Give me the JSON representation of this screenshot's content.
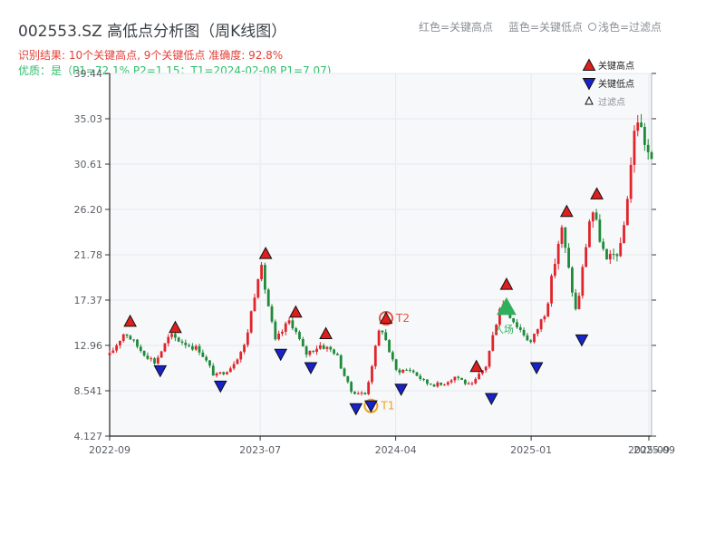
{
  "header": {
    "title": "002553.SZ 高低点分析图（周K线图）",
    "summary": "识别结果: 10个关键高点, 9个关键低点  准确度: 92.8%",
    "quality": "优质：是（P1=72.1%  P2=1.15；T1=2024-02-08 P1=7.07)",
    "legend_top": [
      "红色=关键高点",
      "蓝色=关键低点",
      "浅色=过滤点"
    ]
  },
  "colors": {
    "up": "#e0242b",
    "down": "#1e8a3a",
    "high_marker": "#e01e1e",
    "low_marker": "#1722c8",
    "t1": "#f0a020",
    "t2": "#e05540",
    "entry": "#2fae5c",
    "plot_bg": "#f7f8fa",
    "grid": "#e6e8ec"
  },
  "chart_data": {
    "type": "candlestick",
    "y_ticks": [
      4.127,
      8.541,
      12.96,
      17.37,
      21.78,
      26.2,
      30.61,
      35.03,
      39.44
    ],
    "y_tick_labels": [
      "4.127",
      "8.541",
      "12.96",
      "17.37",
      "21.78",
      "26.20",
      "30.61",
      "35.03",
      "39.44"
    ],
    "ylim": [
      4.127,
      39.44
    ],
    "x_ticks": [
      "2022-09",
      "2023-07",
      "2024-04",
      "2025-01",
      "2025-09"
    ],
    "x_tick_labels_shown": [
      "2022-09",
      "2023-07",
      "2024-04",
      "2025-01",
      "2025-09",
      "2025-09"
    ],
    "xlim": [
      "2022-09",
      "2025-09"
    ],
    "legend": [
      "关键高点",
      "关键低点",
      "过滤点"
    ],
    "legend_placement": "top-right",
    "grid": true,
    "price_path": [
      [
        "2022-09",
        12.0
      ],
      [
        "2022-10",
        14.3
      ],
      [
        "2022-11",
        12.6
      ],
      [
        "2022-12",
        11.3
      ],
      [
        "2023-01",
        13.9
      ],
      [
        "2023-02",
        13.2
      ],
      [
        "2023-03",
        12.5
      ],
      [
        "2023-04",
        9.9
      ],
      [
        "2023-05",
        10.8
      ],
      [
        "2023-06",
        13.0
      ],
      [
        "2023-07",
        21.0
      ],
      [
        "2023-08",
        13.3
      ],
      [
        "2023-09",
        15.5
      ],
      [
        "2023-10",
        12.1
      ],
      [
        "2023-11",
        13.0
      ],
      [
        "2023-12",
        12.3
      ],
      [
        "2024-01",
        8.5
      ],
      [
        "2024-02",
        8.2
      ],
      [
        "2024-03",
        15.0
      ],
      [
        "2024-04",
        10.5
      ],
      [
        "2024-05",
        10.6
      ],
      [
        "2024-06",
        9.3
      ],
      [
        "2024-07",
        9.1
      ],
      [
        "2024-08",
        10.0
      ],
      [
        "2024-09",
        8.9
      ],
      [
        "2024-10",
        11.0
      ],
      [
        "2024-11",
        17.3
      ],
      [
        "2024-12",
        15.0
      ],
      [
        "2025-01",
        13.2
      ],
      [
        "2025-02",
        16.5
      ],
      [
        "2025-03",
        24.5
      ],
      [
        "2025-04",
        16.0
      ],
      [
        "2025-05",
        26.5
      ],
      [
        "2025-06",
        21.0
      ],
      [
        "2025-07",
        22.5
      ],
      [
        "2025-08",
        35.5
      ],
      [
        "2025-09",
        30.6
      ]
    ],
    "key_highs": [
      {
        "x": "2022-10",
        "y": 14.6
      },
      {
        "x": "2023-01",
        "y": 14.0
      },
      {
        "x": "2023-07",
        "y": 21.2
      },
      {
        "x": "2023-09",
        "y": 15.5
      },
      {
        "x": "2023-11",
        "y": 13.4
      },
      {
        "x": "2024-09",
        "y": 10.2
      },
      {
        "x": "2024-11",
        "y": 18.2
      },
      {
        "x": "2025-03",
        "y": 25.3
      },
      {
        "x": "2025-05",
        "y": 27.0
      }
    ],
    "key_lows": [
      {
        "x": "2022-12",
        "y": 11.2
      },
      {
        "x": "2023-04",
        "y": 9.7
      },
      {
        "x": "2023-08",
        "y": 12.8
      },
      {
        "x": "2023-10",
        "y": 11.5
      },
      {
        "x": "2024-01",
        "y": 7.5
      },
      {
        "x": "2024-04",
        "y": 9.4
      },
      {
        "x": "2024-10",
        "y": 8.5
      },
      {
        "x": "2025-01",
        "y": 11.5
      },
      {
        "x": "2025-04",
        "y": 14.2
      }
    ],
    "special_points": [
      {
        "label": "T1",
        "x": "2024-02",
        "y": 7.07
      },
      {
        "label": "T2",
        "x": "2024-03",
        "y": 15.6
      }
    ],
    "entry_point": {
      "label": "入场",
      "x": "2024-11",
      "y": 16.5
    }
  }
}
